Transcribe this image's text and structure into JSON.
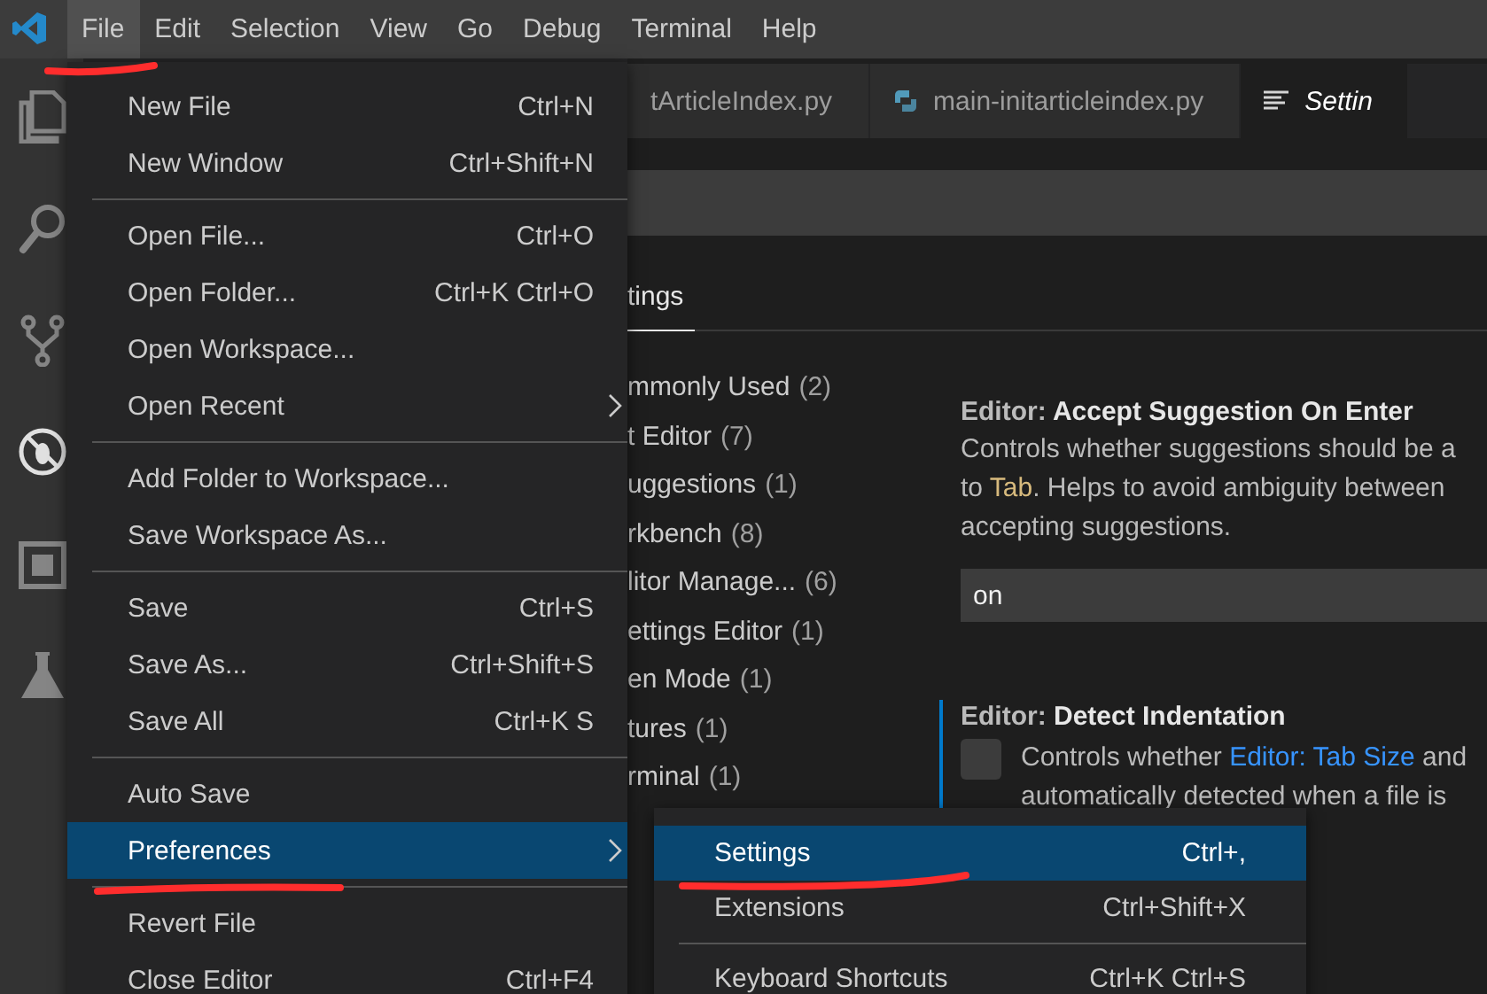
{
  "menubar": [
    {
      "label": "File",
      "selected": true
    },
    {
      "label": "Edit",
      "selected": false
    },
    {
      "label": "Selection",
      "selected": false
    },
    {
      "label": "View",
      "selected": false
    },
    {
      "label": "Go",
      "selected": false
    },
    {
      "label": "Debug",
      "selected": false
    },
    {
      "label": "Terminal",
      "selected": false
    },
    {
      "label": "Help",
      "selected": false
    }
  ],
  "tabs": [
    {
      "label": "tArticleIndex.py",
      "kind": "plain",
      "selected": false
    },
    {
      "label": "main-initarticleindex.py",
      "kind": "python",
      "selected": false
    },
    {
      "label": "Settin",
      "kind": "settings",
      "selected": true
    }
  ],
  "settings_tabs": [
    {
      "label": "tings",
      "selected": true
    }
  ],
  "toc": [
    {
      "label": "mmonly Used",
      "count": "(2)"
    },
    {
      "label": "t Editor",
      "count": "(7)"
    },
    {
      "label": "uggestions",
      "count": "(1)"
    },
    {
      "label": "rkbench",
      "count": "(8)"
    },
    {
      "label": "litor Manage...",
      "count": "(6)"
    },
    {
      "label": "ettings Editor",
      "count": "(1)"
    },
    {
      "label": "en Mode",
      "count": "(1)"
    },
    {
      "label": "tures",
      "count": "(1)"
    },
    {
      "label": "rminal",
      "count": "(1)"
    }
  ],
  "settings": [
    {
      "kind": "dropdown",
      "focused": false,
      "category": "Editor: ",
      "title": "Accept Suggestion On Enter",
      "value": "on",
      "description": [
        [
          {
            "kind": "plain",
            "text": "Controls whether suggestions should be a"
          }
        ],
        [
          {
            "kind": "plain",
            "text": "to "
          },
          {
            "kind": "code",
            "text": "Tab"
          },
          {
            "kind": "plain",
            "text": ". Helps to avoid ambiguity between"
          }
        ],
        [
          {
            "kind": "plain",
            "text": "accepting suggestions."
          }
        ]
      ]
    },
    {
      "kind": "checkbox",
      "focused": true,
      "checked": false,
      "category": "Editor: ",
      "title": "Detect Indentation",
      "description": [
        [
          {
            "kind": "plain",
            "text": "Controls whether "
          },
          {
            "kind": "link",
            "text": "Editor: Tab Size"
          },
          {
            "kind": "plain",
            "text": " and"
          }
        ],
        [
          {
            "kind": "plain",
            "text": "automatically detected when a file is"
          }
        ]
      ]
    }
  ],
  "file_menu": [
    {
      "kind": "item",
      "label": "New File",
      "shortcut": "Ctrl+N",
      "submenu": false,
      "selected": false
    },
    {
      "kind": "item",
      "label": "New Window",
      "shortcut": "Ctrl+Shift+N",
      "submenu": false,
      "selected": false
    },
    {
      "kind": "separator"
    },
    {
      "kind": "item",
      "label": "Open File...",
      "shortcut": "Ctrl+O",
      "submenu": false,
      "selected": false
    },
    {
      "kind": "item",
      "label": "Open Folder...",
      "shortcut": "Ctrl+K Ctrl+O",
      "submenu": false,
      "selected": false
    },
    {
      "kind": "item",
      "label": "Open Workspace...",
      "submenu": false,
      "selected": false
    },
    {
      "kind": "item",
      "label": "Open Recent",
      "submenu": true,
      "selected": false
    },
    {
      "kind": "separator"
    },
    {
      "kind": "item",
      "label": "Add Folder to Workspace...",
      "submenu": false,
      "selected": false
    },
    {
      "kind": "item",
      "label": "Save Workspace As...",
      "submenu": false,
      "selected": false
    },
    {
      "kind": "separator"
    },
    {
      "kind": "item",
      "label": "Save",
      "shortcut": "Ctrl+S",
      "submenu": false,
      "selected": false
    },
    {
      "kind": "item",
      "label": "Save As...",
      "shortcut": "Ctrl+Shift+S",
      "submenu": false,
      "selected": false
    },
    {
      "kind": "item",
      "label": "Save All",
      "shortcut": "Ctrl+K S",
      "submenu": false,
      "selected": false
    },
    {
      "kind": "separator"
    },
    {
      "kind": "item",
      "label": "Auto Save",
      "submenu": false,
      "selected": false
    },
    {
      "kind": "item",
      "label": "Preferences",
      "submenu": true,
      "selected": true
    },
    {
      "kind": "separator"
    },
    {
      "kind": "item",
      "label": "Revert File",
      "submenu": false,
      "selected": false
    },
    {
      "kind": "item",
      "label": "Close Editor",
      "shortcut": "Ctrl+F4",
      "submenu": false,
      "selected": false
    }
  ],
  "submenu": [
    {
      "kind": "item",
      "label": "Settings",
      "shortcut": "Ctrl+,",
      "submenu": false,
      "selected": true
    },
    {
      "kind": "item",
      "label": "Extensions",
      "shortcut": "Ctrl+Shift+X",
      "submenu": false,
      "selected": false
    },
    {
      "kind": "separator"
    },
    {
      "kind": "item",
      "label": "Keyboard Shortcuts",
      "shortcut": "Ctrl+K Ctrl+S",
      "submenu": false,
      "selected": false
    }
  ]
}
